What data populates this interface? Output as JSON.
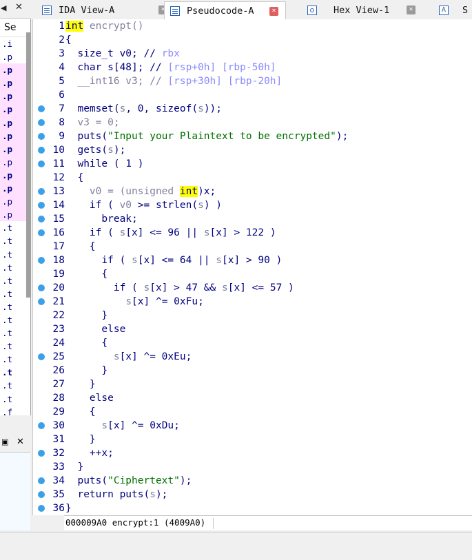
{
  "left_panel": {
    "tab_triangle": "◀",
    "close": "✕",
    "header": "Se",
    "rows": [
      {
        "t": ".i",
        "hl": false,
        "b": false
      },
      {
        "t": ".p",
        "hl": false,
        "b": false
      },
      {
        "t": ".p",
        "hl": true,
        "b": true
      },
      {
        "t": ".p",
        "hl": true,
        "b": true
      },
      {
        "t": ".p",
        "hl": true,
        "b": true
      },
      {
        "t": ".p",
        "hl": true,
        "b": true
      },
      {
        "t": ".p",
        "hl": true,
        "b": true
      },
      {
        "t": ".p",
        "hl": true,
        "b": true
      },
      {
        "t": ".p",
        "hl": true,
        "b": true
      },
      {
        "t": ".p",
        "hl": true,
        "b": false
      },
      {
        "t": ".p",
        "hl": true,
        "b": true
      },
      {
        "t": ".p",
        "hl": true,
        "b": true
      },
      {
        "t": ".p",
        "hl": true,
        "b": false
      },
      {
        "t": ".p",
        "hl": true,
        "b": false
      },
      {
        "t": ".t",
        "hl": false,
        "b": false
      },
      {
        "t": ".t",
        "hl": false,
        "b": false
      },
      {
        "t": ".t",
        "hl": false,
        "b": false
      },
      {
        "t": ".t",
        "hl": false,
        "b": false
      },
      {
        "t": ".t",
        "hl": false,
        "b": false
      },
      {
        "t": ".t",
        "hl": false,
        "b": false
      },
      {
        "t": ".t",
        "hl": false,
        "b": false
      },
      {
        "t": ".t",
        "hl": false,
        "b": false
      },
      {
        "t": ".t",
        "hl": false,
        "b": false
      },
      {
        "t": ".t",
        "hl": false,
        "b": false
      },
      {
        "t": ".t",
        "hl": false,
        "b": false
      },
      {
        "t": ".t",
        "hl": false,
        "b": true
      },
      {
        "t": ".t",
        "hl": false,
        "b": false
      },
      {
        "t": ".t",
        "hl": false,
        "b": false
      },
      {
        "t": ".f",
        "hl": false,
        "b": false
      }
    ],
    "tab2_icon": "▣",
    "tab2_close": "✕"
  },
  "tabs": [
    {
      "label": "IDA View-A",
      "icon": "list",
      "active": false
    },
    {
      "label": "Pseudocode-A",
      "icon": "list",
      "active": true
    },
    {
      "label": "Hex View-1",
      "icon": "hex",
      "active": false
    },
    {
      "label": "S",
      "icon": "letter",
      "active": false,
      "letter": "A"
    }
  ],
  "close_glyph": "×",
  "code_lines": [
    {
      "n": "1",
      "dot": false,
      "segs": [
        [
          "int",
          "hlk"
        ],
        [
          " encrypt()",
          "gr"
        ]
      ]
    },
    {
      "n": "2",
      "dot": false,
      "segs": [
        [
          "{",
          ""
        ]
      ]
    },
    {
      "n": "3",
      "dot": false,
      "segs": [
        [
          "  size_t v0; // ",
          ""
        ],
        [
          "rbx",
          "cm"
        ]
      ]
    },
    {
      "n": "4",
      "dot": false,
      "segs": [
        [
          "  char s[48]; // ",
          ""
        ],
        [
          "[rsp+0h] [rbp-50h]",
          "cm"
        ]
      ]
    },
    {
      "n": "5",
      "dot": false,
      "segs": [
        [
          "  __int16 v3; // ",
          "gr"
        ],
        [
          "[rsp+30h] [rbp-20h]",
          "cm"
        ]
      ]
    },
    {
      "n": "6",
      "dot": false,
      "segs": []
    },
    {
      "n": "7",
      "dot": true,
      "segs": [
        [
          "  memset(",
          ""
        ],
        [
          "s",
          "gr"
        ],
        [
          ", 0, sizeof(",
          ""
        ],
        [
          "s",
          "gr"
        ],
        [
          "));",
          ""
        ]
      ]
    },
    {
      "n": "8",
      "dot": true,
      "segs": [
        [
          "  v3 = 0;",
          "gr"
        ]
      ]
    },
    {
      "n": "9",
      "dot": true,
      "segs": [
        [
          "  puts(",
          ""
        ],
        [
          "\"Input your Plaintext to be encrypted\"",
          "st"
        ],
        [
          ");",
          ""
        ]
      ]
    },
    {
      "n": "10",
      "dot": true,
      "segs": [
        [
          "  gets(",
          ""
        ],
        [
          "s",
          "gr"
        ],
        [
          ");",
          ""
        ]
      ]
    },
    {
      "n": "11",
      "dot": true,
      "segs": [
        [
          "  while ( 1 )",
          ""
        ]
      ]
    },
    {
      "n": "12",
      "dot": false,
      "segs": [
        [
          "  {",
          ""
        ]
      ]
    },
    {
      "n": "13",
      "dot": true,
      "segs": [
        [
          "    v0 = (unsigned ",
          "gr"
        ],
        [
          "int",
          "hlk"
        ],
        [
          ")x;",
          ""
        ]
      ]
    },
    {
      "n": "14",
      "dot": true,
      "segs": [
        [
          "    if ( ",
          ""
        ],
        [
          "v0",
          "gr"
        ],
        [
          " >= strlen(",
          ""
        ],
        [
          "s",
          "gr"
        ],
        [
          ") )",
          ""
        ]
      ]
    },
    {
      "n": "15",
      "dot": true,
      "segs": [
        [
          "      break;",
          ""
        ]
      ]
    },
    {
      "n": "16",
      "dot": true,
      "segs": [
        [
          "    if ( ",
          ""
        ],
        [
          "s",
          "gr"
        ],
        [
          "[x] <= 96 || ",
          ""
        ],
        [
          "s",
          "gr"
        ],
        [
          "[x] > 122 )",
          ""
        ]
      ]
    },
    {
      "n": "17",
      "dot": false,
      "segs": [
        [
          "    {",
          ""
        ]
      ]
    },
    {
      "n": "18",
      "dot": true,
      "segs": [
        [
          "      if ( ",
          ""
        ],
        [
          "s",
          "gr"
        ],
        [
          "[x] <= 64 || ",
          ""
        ],
        [
          "s",
          "gr"
        ],
        [
          "[x] > 90 )",
          ""
        ]
      ]
    },
    {
      "n": "19",
      "dot": false,
      "segs": [
        [
          "      {",
          ""
        ]
      ]
    },
    {
      "n": "20",
      "dot": true,
      "segs": [
        [
          "        if ( ",
          ""
        ],
        [
          "s",
          "gr"
        ],
        [
          "[x] > 47 && ",
          ""
        ],
        [
          "s",
          "gr"
        ],
        [
          "[x] <= 57 )",
          ""
        ]
      ]
    },
    {
      "n": "21",
      "dot": true,
      "segs": [
        [
          "          ",
          ""
        ],
        [
          "s",
          "gr"
        ],
        [
          "[x] ^= 0xFu;",
          ""
        ]
      ]
    },
    {
      "n": "22",
      "dot": false,
      "segs": [
        [
          "      }",
          ""
        ]
      ]
    },
    {
      "n": "23",
      "dot": false,
      "segs": [
        [
          "      else",
          ""
        ]
      ]
    },
    {
      "n": "24",
      "dot": false,
      "segs": [
        [
          "      {",
          ""
        ]
      ]
    },
    {
      "n": "25",
      "dot": true,
      "segs": [
        [
          "        ",
          ""
        ],
        [
          "s",
          "gr"
        ],
        [
          "[x] ^= 0xEu;",
          ""
        ]
      ]
    },
    {
      "n": "26",
      "dot": false,
      "segs": [
        [
          "      }",
          ""
        ]
      ]
    },
    {
      "n": "27",
      "dot": false,
      "segs": [
        [
          "    }",
          ""
        ]
      ]
    },
    {
      "n": "28",
      "dot": false,
      "segs": [
        [
          "    else",
          ""
        ]
      ]
    },
    {
      "n": "29",
      "dot": false,
      "segs": [
        [
          "    {",
          ""
        ]
      ]
    },
    {
      "n": "30",
      "dot": true,
      "segs": [
        [
          "      ",
          ""
        ],
        [
          "s",
          "gr"
        ],
        [
          "[x] ^= 0xDu;",
          ""
        ]
      ]
    },
    {
      "n": "31",
      "dot": false,
      "segs": [
        [
          "    }",
          ""
        ]
      ]
    },
    {
      "n": "32",
      "dot": true,
      "segs": [
        [
          "    ++x;",
          ""
        ]
      ]
    },
    {
      "n": "33",
      "dot": false,
      "segs": [
        [
          "  }",
          ""
        ]
      ]
    },
    {
      "n": "34",
      "dot": true,
      "segs": [
        [
          "  puts(",
          ""
        ],
        [
          "\"Ciphertext\"",
          "st"
        ],
        [
          ");",
          ""
        ]
      ]
    },
    {
      "n": "35",
      "dot": true,
      "segs": [
        [
          "  return puts(",
          ""
        ],
        [
          "s",
          "gr"
        ],
        [
          ");",
          ""
        ]
      ]
    },
    {
      "n": "36",
      "dot": true,
      "segs": [
        [
          "}",
          ""
        ]
      ]
    }
  ],
  "status": {
    "text": "000009A0 encrypt:1 (4009A0)"
  }
}
